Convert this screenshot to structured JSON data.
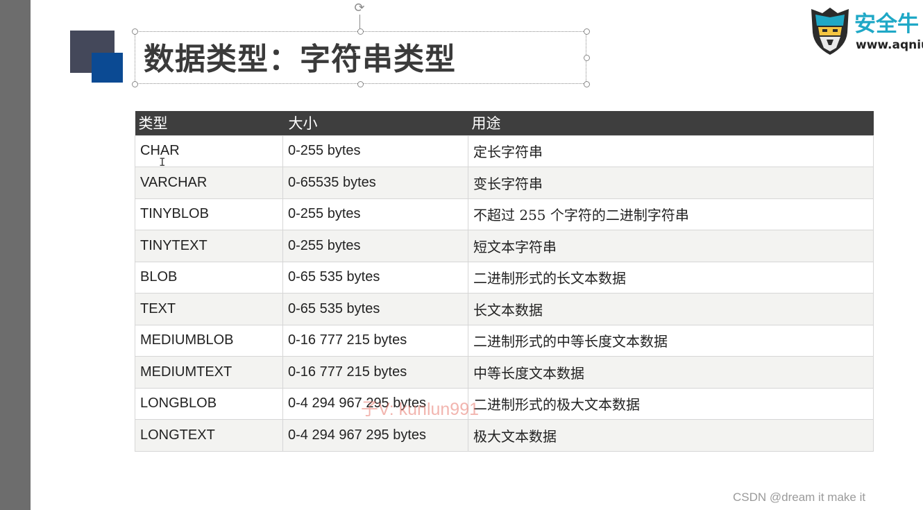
{
  "slide": {
    "title": "数据类型：字符串类型",
    "logo": {
      "name": "安全牛",
      "url": "www.aqniu"
    },
    "table": {
      "headers": [
        "类型",
        "大小",
        "用途"
      ],
      "rows": [
        {
          "type": "CHAR",
          "size": "0-255 bytes",
          "use": "定长字符串"
        },
        {
          "type": "VARCHAR",
          "size": "0-65535 bytes",
          "use": "变长字符串"
        },
        {
          "type": "TINYBLOB",
          "size": "0-255 bytes",
          "use": "不超过 255 个字符的二进制字符串"
        },
        {
          "type": "TINYTEXT",
          "size": "0-255 bytes",
          "use": "短文本字符串"
        },
        {
          "type": "BLOB",
          "size": "0-65 535 bytes",
          "use": "二进制形式的长文本数据"
        },
        {
          "type": "TEXT",
          "size": "0-65 535 bytes",
          "use": "长文本数据"
        },
        {
          "type": "MEDIUMBLOB",
          "size": "0-16 777 215 bytes",
          "use": "二进制形式的中等长度文本数据"
        },
        {
          "type": "MEDIUMTEXT",
          "size": "0-16 777 215 bytes",
          "use": "中等长度文本数据"
        },
        {
          "type": "LONGBLOB",
          "size": "0-4 294 967 295 bytes",
          "use": "二进制形式的极大文本数据"
        },
        {
          "type": "LONGTEXT",
          "size": "0-4 294 967 295 bytes",
          "use": "极大文本数据"
        }
      ]
    },
    "watermark": "子V: kunlun991"
  },
  "footer": {
    "credit": "CSDN @dream it make it"
  },
  "colors": {
    "header_bg": "#3e3e3e",
    "accent_blue": "#0b4a93",
    "accent_dark": "#44485a",
    "logo_teal": "#1fa8c6"
  }
}
